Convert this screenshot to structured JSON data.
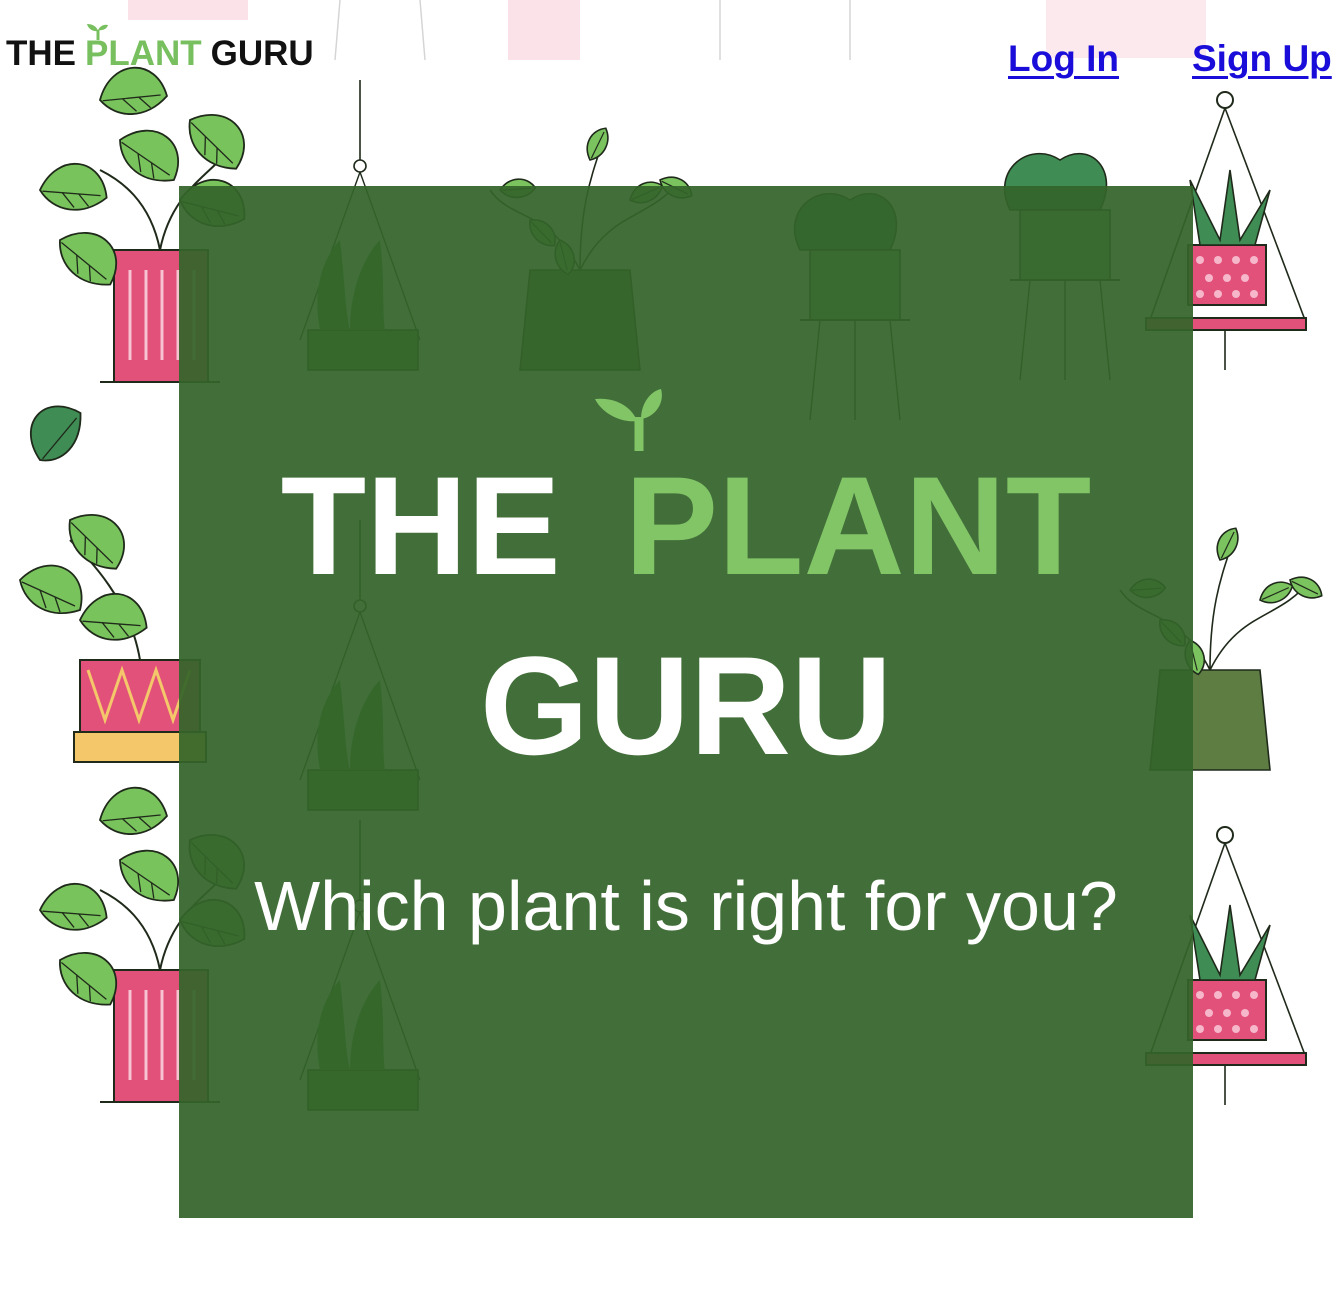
{
  "nav": {
    "logo": {
      "word1": "THE",
      "word2": "PLANT",
      "word3": "GURU"
    },
    "login_label": "Log In",
    "signup_label": "Sign Up"
  },
  "hero": {
    "title_word1": "THE",
    "title_word2": "PLANT",
    "title_word3": "GURU",
    "subtitle": "Which plant is right for you?"
  },
  "colors": {
    "brand_green": "#78c05f",
    "hero_panel": "#34642a",
    "link": "#1a0dd9",
    "pot_pink": "#e2517a"
  },
  "background": {
    "pattern_icon": "potted-plants-pattern"
  }
}
